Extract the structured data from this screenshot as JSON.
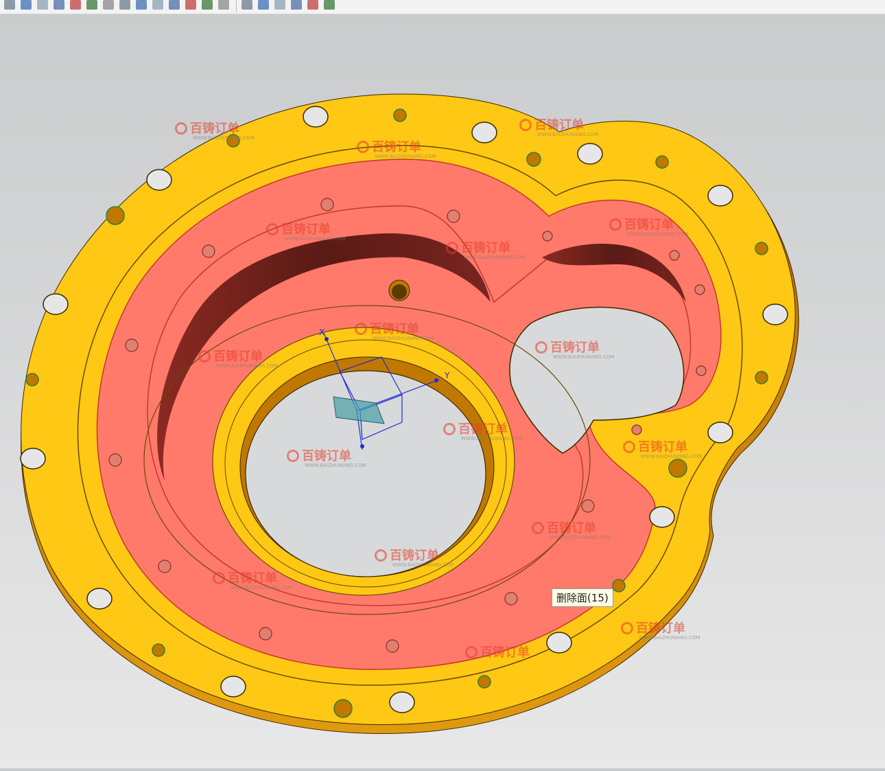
{
  "toolbar": {
    "icons": [
      "select-icon",
      "box-select-icon",
      "cube-icon",
      "shaded-cube-icon",
      "snap-point-icon",
      "line-icon",
      "arc-icon",
      "axis-icon",
      "circle-center-icon",
      "point-icon",
      "plus-icon",
      "edit-icon",
      "display-icon",
      "layer-icon",
      "view-icon",
      "refresh-icon",
      "grid-icon",
      "render-icon",
      "cube-view-icon",
      "material-icon"
    ]
  },
  "tooltip": {
    "text": "删除面(15)"
  },
  "csys": {
    "x_label": "X",
    "y_label": "Y"
  },
  "watermark": {
    "brand": "百铸订单",
    "url": "WWW.BAIZHUWANG.COM"
  },
  "colors": {
    "part_face": "#ffc814",
    "part_side": "#d88a00",
    "selected_face": "#ff7a6a",
    "background_top": "#c9cbcc",
    "background_bottom": "#e8e8e9"
  }
}
